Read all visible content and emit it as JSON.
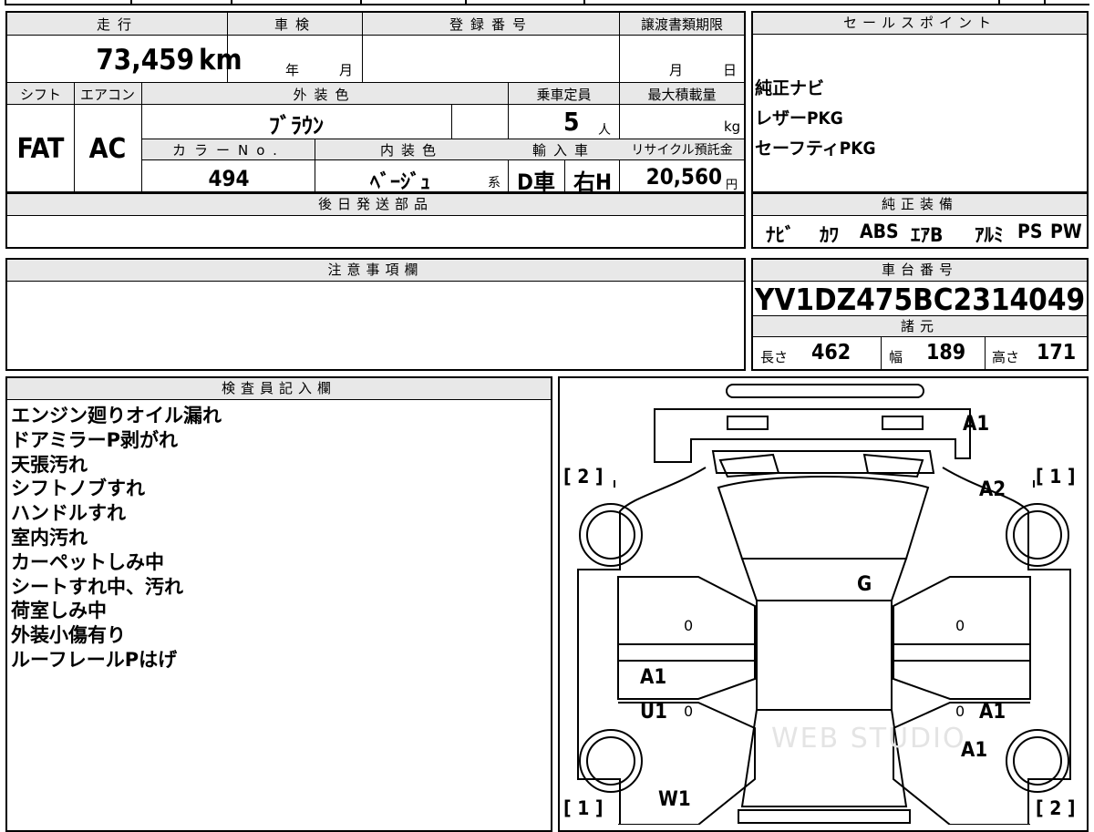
{
  "top_strip": [
    "",
    "",
    "",
    "",
    "",
    ""
  ],
  "spec": {
    "headers": {
      "mileage": "走行",
      "shaken": "車検",
      "registration": "登録番号",
      "transfer_deadline": "譲渡書類期限",
      "shift": "シフト",
      "aircon": "エアコン",
      "exterior_color": "外装色",
      "capacity": "乗車定員",
      "max_load": "最大積載量",
      "color_no": "カラーNo.",
      "interior_color": "内装色",
      "import": "輸入車",
      "recycle": "リサイクル預託金"
    },
    "mileage_value": "73,459",
    "mileage_unit": "km",
    "shaken_year": "年",
    "shaken_month": "月",
    "registration_value": "",
    "transfer_month": "月",
    "transfer_day": "日",
    "shift_value": "FAT",
    "aircon_value": "AC",
    "exterior_color_value": "ﾌﾞﾗｳﾝ",
    "capacity_value": "5",
    "capacity_unit": "人",
    "max_load_unit": "kg",
    "color_no_value": "494",
    "interior_color_value": "ﾍﾞｰｼﾞｭ",
    "interior_color_suffix": "系",
    "import_drive": "D車",
    "import_handle": "右H",
    "recycle_value": "20,560",
    "recycle_unit": "円"
  },
  "sales_points": {
    "header": "セールスポイント",
    "items": [
      "純正ナビ",
      "レザーPKG",
      "セーフティPKG"
    ]
  },
  "genuine_equipment": {
    "header": "純正装備",
    "items": [
      "ﾅﾋﾞ",
      "ｶﾜ",
      "ABS",
      "ｴｱB",
      "ｱﾙﾐ",
      "PS",
      "PW"
    ]
  },
  "later_parts": {
    "header": "後日発送部品",
    "value": ""
  },
  "notes": {
    "header": "注意事項欄",
    "value": ""
  },
  "chassis": {
    "header": "車台番号",
    "number": "YV1DZ475BC2314049",
    "dims_header": "諸元",
    "length_label": "長さ",
    "length_value": "462",
    "width_label": "幅",
    "width_value": "189",
    "height_label": "高さ",
    "height_value": "171"
  },
  "inspector": {
    "header": "検査員記入欄",
    "remarks": [
      "エンジン廻りオイル漏れ",
      "ドアミラーP剥がれ",
      "天張汚れ",
      "シフトノブすれ",
      "ハンドルすれ",
      "室内汚れ",
      "カーペットしみ中",
      "シートすれ中、汚れ",
      "荷室しみ中",
      "外装小傷有り",
      "ルーフレールPはげ"
    ]
  },
  "diagram": {
    "marks": {
      "rear_right": "A1",
      "right_rear_fender": "A2",
      "glass": "G",
      "left_rear_door_a": "A1",
      "left_rear_door_u": "U1",
      "right_door": "A1",
      "right_front_fender": "A1",
      "windshield": "W1",
      "left_zero_1": "0",
      "left_zero_2": "0",
      "right_zero_1": "0",
      "right_zero_2": "0"
    },
    "tire_labels": {
      "top_left": "[ 2 ]",
      "top_right": "[ 1 ]",
      "bottom_left": "[ 1 ]",
      "bottom_right": "[ 2 ]"
    },
    "watermark": "WEB STUDIO"
  }
}
